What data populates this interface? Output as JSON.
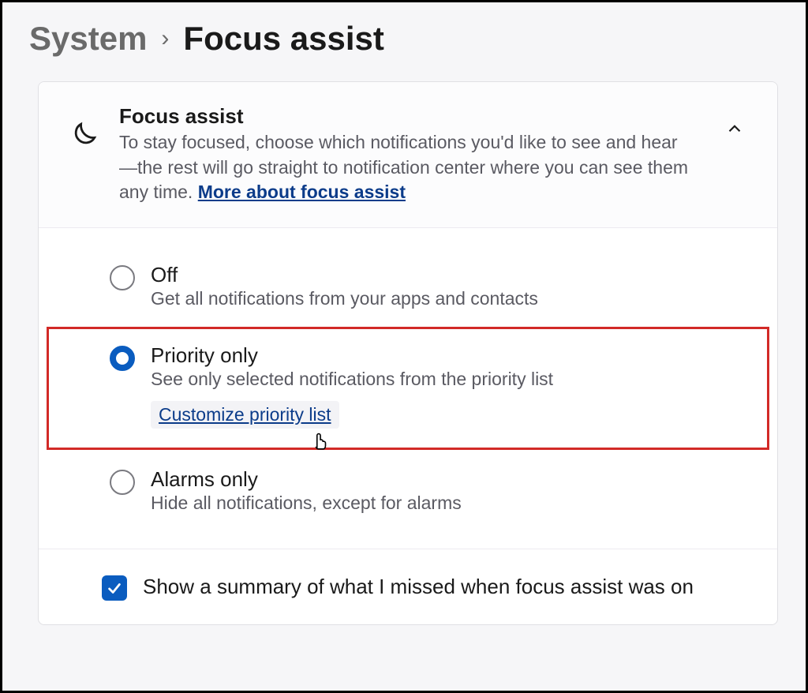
{
  "breadcrumb": {
    "parent": "System",
    "separator": "›",
    "current": "Focus assist"
  },
  "header": {
    "title": "Focus assist",
    "description_pre": "To stay focused, choose which notifications you'd like to see and hear—the rest will go straight to notification center where you can see them any time.  ",
    "link_text": "More about focus assist"
  },
  "options": {
    "off": {
      "title": "Off",
      "desc": "Get all notifications from your apps and contacts"
    },
    "priority": {
      "title": "Priority only",
      "desc": "See only selected notifications from the priority list",
      "customize": "Customize priority list"
    },
    "alarms": {
      "title": "Alarms only",
      "desc": "Hide all notifications, except for alarms"
    }
  },
  "footer": {
    "label": "Show a summary of what I missed when focus assist was on"
  }
}
